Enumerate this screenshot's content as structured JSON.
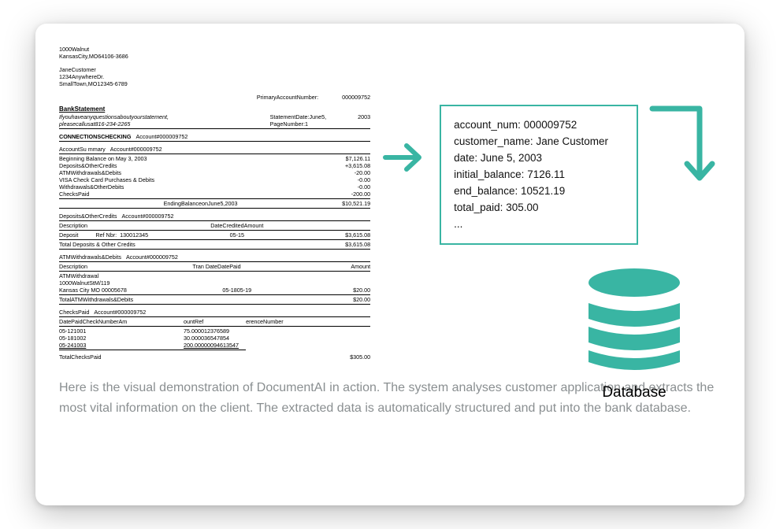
{
  "colors": {
    "accent": "#39b5a3"
  },
  "statement": {
    "bank_addr1": "1000Walnut",
    "bank_addr2": "KansasCity,MO64106-3686",
    "cust_name": "JaneCustomer",
    "cust_addr1": "1234AnywhereDr.",
    "cust_addr2": "SmallTown,MO12345-6789",
    "primary_label": "PrimaryAccountNumber:",
    "primary_value": "000009752",
    "title": "BankStatement",
    "questions1": "Ifyouhaveanyquestionsaboutyourstatement,",
    "questions2": "pleasecallusat816-234-2265",
    "stmt_date_label": "StatementDate:June5,",
    "stmt_date_year": "2003",
    "page_label": "PageNumber:1",
    "sec1_head": "CONNECTIONSCHECKING",
    "acct": "Account#000009752",
    "sec1_sub": "AccountSu mmary",
    "begin_label": "Beginning Balance on May 3, 2003",
    "begin_val": "$7,126.11",
    "dep_label": "Deposits&OtherCredits",
    "dep_val": "+3,615.08",
    "atm_label": "ATMWithdrawals&Debits",
    "atm_val": "-20.00",
    "visa_label": "VISA Check Card Purchases & Debits",
    "visa_val": "-0.00",
    "wd_label": "Withdrawals&OtherDebits",
    "wd_val": "-0.00",
    "checks_label": "ChecksPaid",
    "checks_val": "-200.00",
    "end_label": "EndingBalanceonJune5,2003",
    "end_val": "$10,521.19",
    "doc_head": "Deposits&OtherCredits",
    "col_desc": "Description",
    "col_date": "DateCreditedAmount",
    "deposit_row_l": "Deposit",
    "deposit_ref_label": "Ref Nbr:",
    "deposit_ref": "130012345",
    "deposit_date": "05-15",
    "deposit_amt": "$3,615.08",
    "total_dep_label": "Total Deposits & Other Credits",
    "total_dep_val": "$3,615.08",
    "atm_head": "ATMWithdrawals&Debits",
    "atm_col_mid": "Tran   DateDatePaid",
    "atm_col_amt": "Amount",
    "atm_r1": "ATMWithdrawal",
    "atm_r2": "1000WalnutStM/119",
    "atm_r3a": "Kansas City MO    00005678",
    "atm_r3b": "05-1805-19",
    "atm_r3c": "$20.00",
    "atm_total_label": "TotalATMWithdrawals&Debits",
    "atm_total_val": "$20.00",
    "cp_head": "ChecksPaid",
    "cp_cols_l": "DatePaidCheckNumberAm",
    "cp_cols_m": "ountRef",
    "cp_cols_r": "erenceNumber",
    "cp_r1a": "05-121001",
    "cp_r1b": "75.000012376589",
    "cp_r2a": "05-181002",
    "cp_r2b": "30.000036547854",
    "cp_r3a": "05-241003",
    "cp_r3b": "200.00000094613547",
    "cp_total_label": "TotalChecksPaid",
    "cp_total_val": "$305.00"
  },
  "extracted": {
    "l1_k": "account_num:",
    "l1_v": "000009752",
    "l2_k": "customer_name:",
    "l2_v": "Jane Customer",
    "l3_k": "date:",
    "l3_v": "June 5, 2003",
    "l4_k": "initial_balance:",
    "l4_v": "7126.11",
    "l5_k": "end_balance:",
    "l5_v": "10521.19",
    "l6_k": "total_paid:",
    "l6_v": "305.00",
    "l7": "..."
  },
  "db_label": "Database",
  "caption": "Here is the visual demonstration of DocumentAI in action. The system analyses customer application and extracts the most vital information on the client. The extracted data is automatically structured and put into the bank database."
}
